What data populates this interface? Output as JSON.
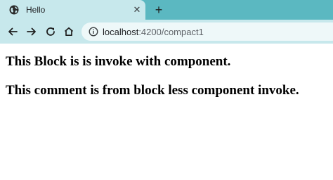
{
  "tab": {
    "title": "Hello",
    "favicon": "globe-icon",
    "close_glyph": "✕"
  },
  "new_tab_glyph": "+",
  "toolbar": {
    "back_icon": "arrow-left-icon",
    "forward_icon": "arrow-right-icon",
    "reload_icon": "reload-icon",
    "home_icon": "home-icon",
    "site_info_icon": "info-icon"
  },
  "address": {
    "host": "localhost",
    "path": ":4200/compact1"
  },
  "content": {
    "line1": "This Block is is invoke with component.",
    "line2": "This comment is from block less component invoke."
  },
  "colors": {
    "tabstrip": "#5bb8c1",
    "toolbar": "#c7e8ec",
    "omnibox": "#eef8f9",
    "text": "#000000"
  }
}
